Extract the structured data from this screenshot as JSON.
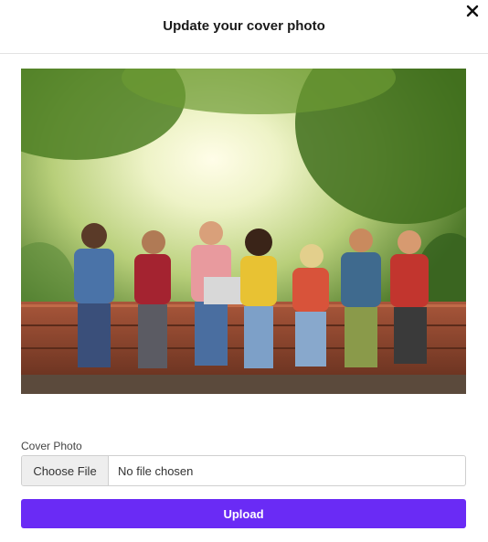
{
  "modal": {
    "title": "Update your cover photo",
    "close_icon": "close-icon"
  },
  "form": {
    "label": "Cover Photo",
    "choose_file_label": "Choose File",
    "file_status": "No file chosen",
    "upload_label": "Upload"
  },
  "colors": {
    "accent": "#6a2bf5"
  }
}
